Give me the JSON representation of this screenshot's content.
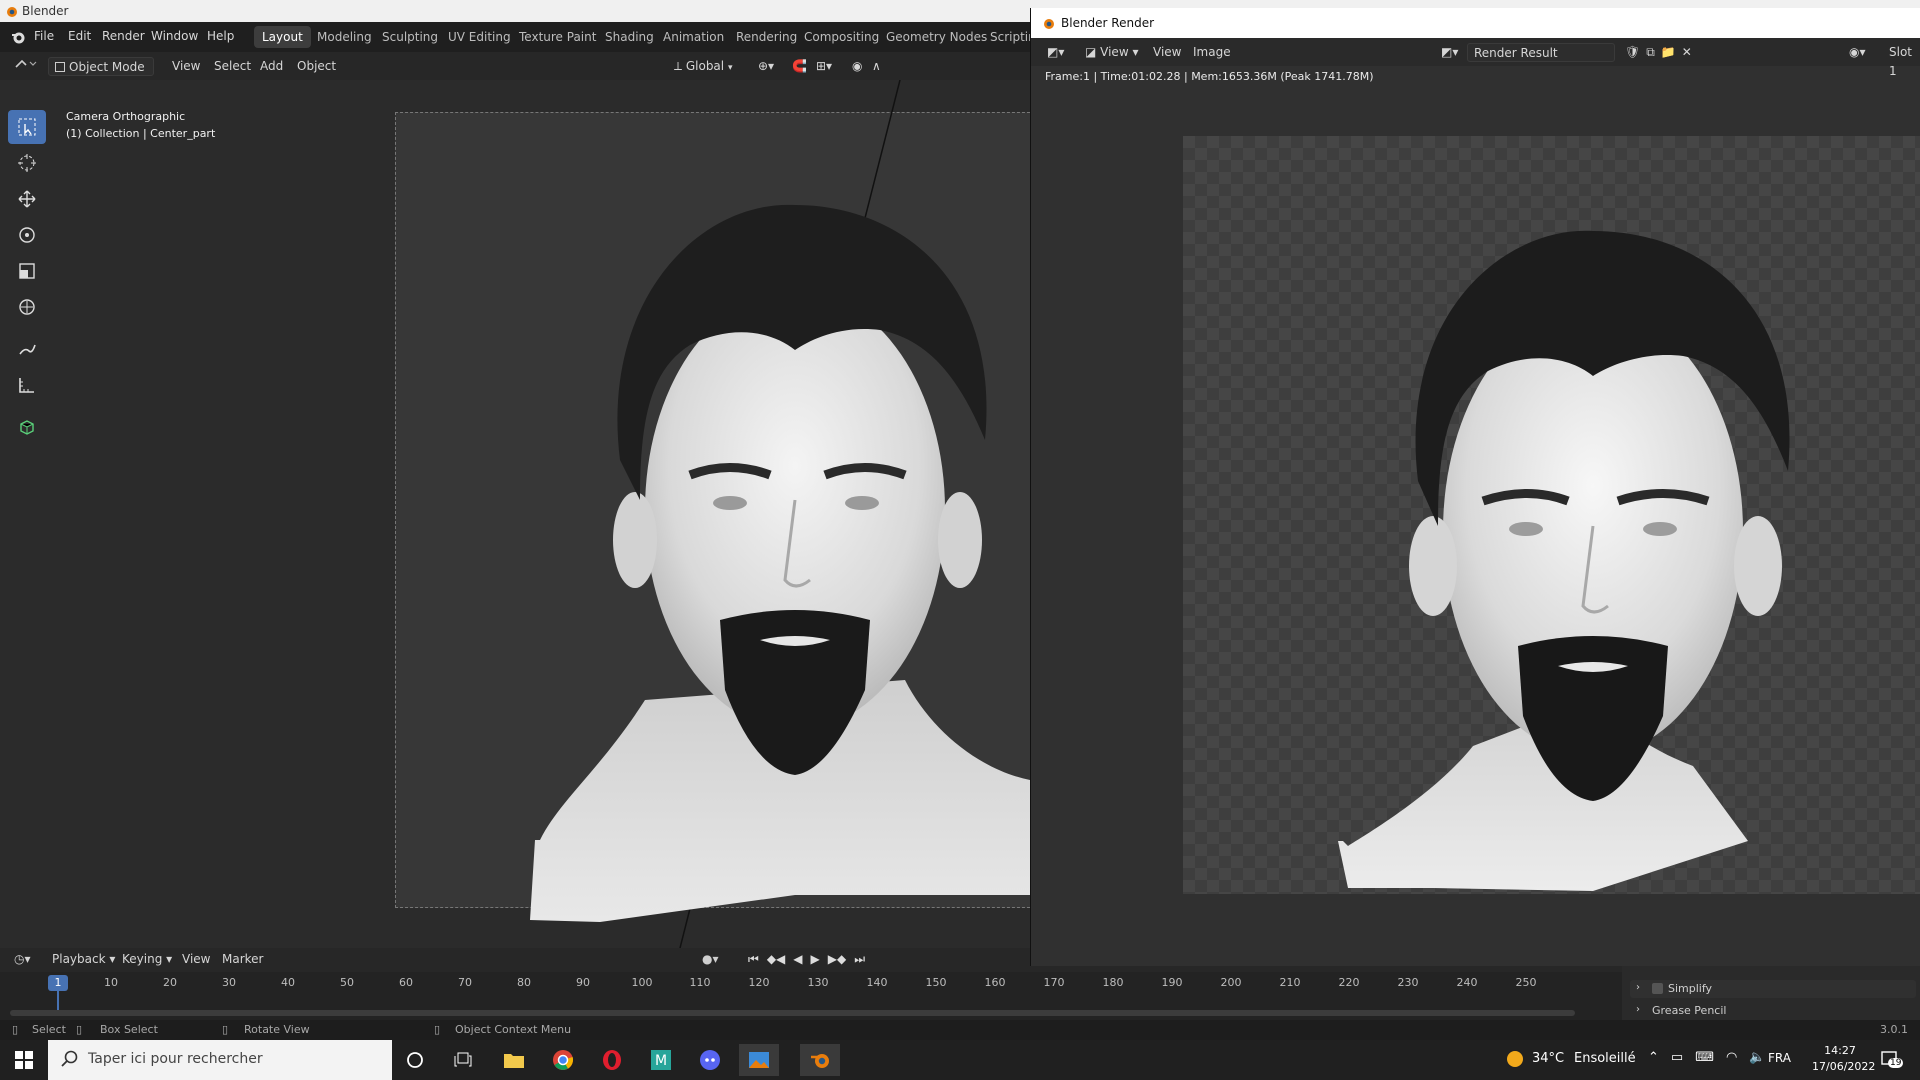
{
  "os": {
    "title": "Blender"
  },
  "menus": [
    "File",
    "Edit",
    "Render",
    "Window",
    "Help"
  ],
  "workspaces": [
    "Layout",
    "Modeling",
    "Sculpting",
    "UV Editing",
    "Texture Paint",
    "Shading",
    "Animation",
    "Rendering",
    "Compositing",
    "Geometry Nodes",
    "Scriptin"
  ],
  "viewport": {
    "mode": "Object Mode",
    "menus": [
      "View",
      "Select",
      "Add",
      "Object"
    ],
    "transform": "Global",
    "overlay_line1": "Camera Orthographic",
    "overlay_line2": "(1) Collection | Center_part"
  },
  "render_window": {
    "title": "Blender Render",
    "menu_view_dropdown": "View",
    "menu_view": "View",
    "menu_image": "Image",
    "image_name": "Render Result",
    "slot": "Slot 1",
    "info": "Frame:1 | Time:01:02.28 | Mem:1653.36M (Peak 1741.78M)"
  },
  "properties": {
    "simplify": "Simplify",
    "grease_pencil": "Grease Pencil",
    "version": "3.0.1"
  },
  "timeline": {
    "menus": [
      "Playback",
      "Keying",
      "View",
      "Marker"
    ],
    "current_frame": "1",
    "frames": [
      "10",
      "20",
      "30",
      "40",
      "50",
      "60",
      "70",
      "80",
      "90",
      "100",
      "110",
      "120",
      "130",
      "140",
      "150",
      "160",
      "170",
      "180",
      "190",
      "200",
      "210",
      "220",
      "230",
      "240",
      "250"
    ]
  },
  "status": {
    "select": "Select",
    "box_select": "Box Select",
    "rotate_view": "Rotate View",
    "context_menu": "Object Context Menu"
  },
  "taskbar": {
    "search_placeholder": "Taper ici pour rechercher",
    "temperature": "34°C",
    "weather": "Ensoleillé",
    "language": "FRA",
    "time": "14:27",
    "date": "17/06/2022",
    "notifications": "19"
  },
  "colors": {
    "accent": "#4772b3",
    "active_frame": "#4772b3"
  }
}
